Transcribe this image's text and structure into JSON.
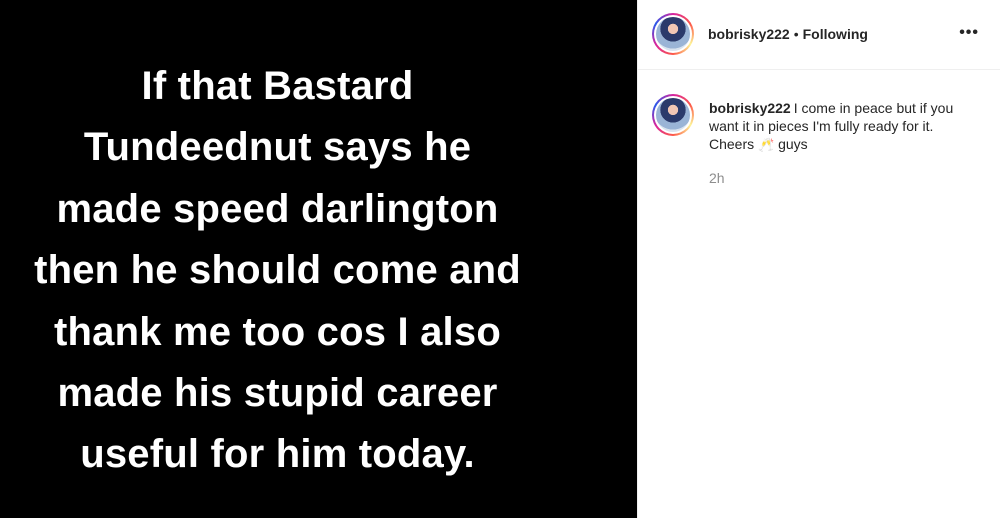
{
  "story": {
    "lines": [
      "If that Bastard",
      "Tundeednut says he",
      "made speed darlington",
      "then he should come and",
      "thank me too cos I also",
      "made his stupid career",
      "useful for him today."
    ]
  },
  "header": {
    "username": "bobrisky222",
    "separator": "•",
    "follow_status": "Following",
    "more_label": "•••"
  },
  "caption": {
    "username": "bobrisky222",
    "text_before": "I come in peace but if you want it in pieces I'm fully ready for it. Cheers ",
    "emoji": "🥂",
    "text_after": " guys",
    "time": "2h"
  },
  "colors": {
    "media_background": "#000000",
    "text_primary": "#262626",
    "text_secondary": "#8e8e8e",
    "divider": "#efefef"
  },
  "icons": {
    "more": "more-options-icon",
    "avatar": "profile-avatar"
  }
}
